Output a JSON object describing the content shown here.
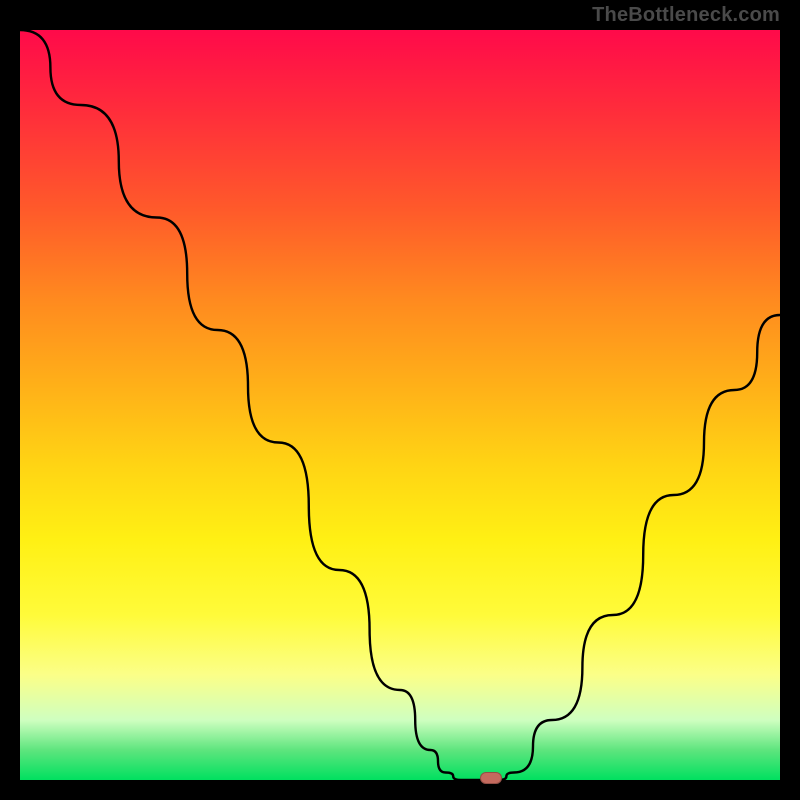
{
  "watermark": "TheBottleneck.com",
  "colors": {
    "frame": "#000000",
    "curve": "#000000",
    "marker": "#c46a5e",
    "gradient_top": "#ff0a4a",
    "gradient_bottom": "#00e060"
  },
  "chart_data": {
    "type": "line",
    "title": "",
    "xlabel": "",
    "ylabel": "",
    "xlim": [
      0,
      100
    ],
    "ylim": [
      0,
      100
    ],
    "grid": false,
    "legend": null,
    "curve_points": [
      {
        "x": 0,
        "y": 100
      },
      {
        "x": 8,
        "y": 90
      },
      {
        "x": 18,
        "y": 75
      },
      {
        "x": 26,
        "y": 60
      },
      {
        "x": 34,
        "y": 45
      },
      {
        "x": 42,
        "y": 28
      },
      {
        "x": 50,
        "y": 12
      },
      {
        "x": 54,
        "y": 4
      },
      {
        "x": 56,
        "y": 1
      },
      {
        "x": 58,
        "y": 0
      },
      {
        "x": 63,
        "y": 0
      },
      {
        "x": 65,
        "y": 1
      },
      {
        "x": 70,
        "y": 8
      },
      {
        "x": 78,
        "y": 22
      },
      {
        "x": 86,
        "y": 38
      },
      {
        "x": 94,
        "y": 52
      },
      {
        "x": 100,
        "y": 62
      }
    ],
    "marker": {
      "x": 62,
      "y": 0
    },
    "annotations": []
  }
}
